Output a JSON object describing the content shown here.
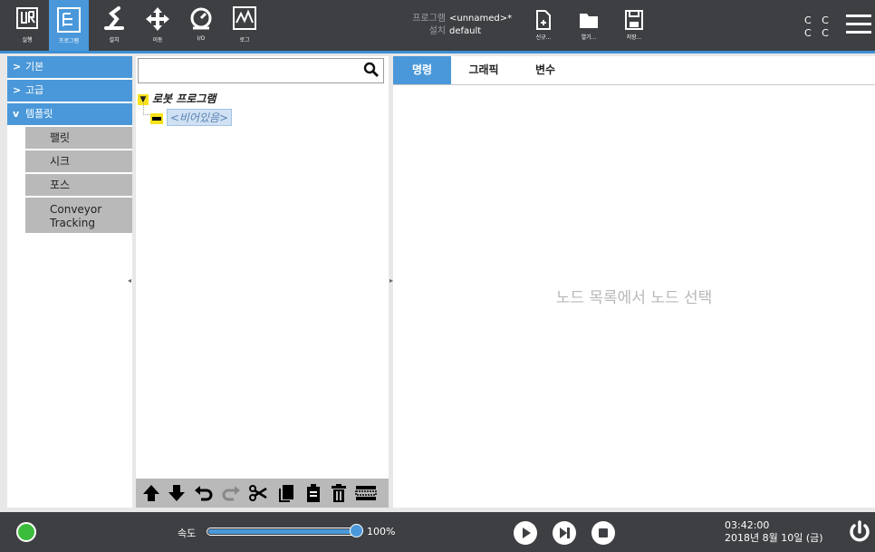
{
  "topnav": {
    "items": [
      {
        "label": "실행"
      },
      {
        "label": "프로그램"
      },
      {
        "label": "설치"
      },
      {
        "label": "이동"
      },
      {
        "label": "I/O"
      },
      {
        "label": "로그"
      }
    ]
  },
  "program_info": {
    "program_label": "프로그램",
    "program_value": "<unnamed>*",
    "install_label": "설치",
    "install_value": "default"
  },
  "file_buttons": {
    "new": "신규...",
    "open": "열기...",
    "save": "저장..."
  },
  "status": {
    "cc_top": "C C",
    "cc_bottom": "C C"
  },
  "left_panel": {
    "categories": [
      {
        "label": "기본",
        "chevron": ">"
      },
      {
        "label": "고급",
        "chevron": ">"
      },
      {
        "label": "템플릿",
        "chevron": "v"
      }
    ],
    "template_items": [
      "팰릿",
      "시크",
      "포스",
      "Conveyor Tracking"
    ]
  },
  "tree": {
    "search_placeholder": "",
    "root_label": "로봇 프로그램",
    "child_label": "<비어있음>"
  },
  "right_panel": {
    "tabs": [
      "명령",
      "그래픽",
      "변수"
    ],
    "placeholder": "노드 목록에서 노드 선택"
  },
  "footer": {
    "speed_label": "속도",
    "speed_value": "100%",
    "speed_fraction": 1.0,
    "time": "03:42:00",
    "date": "2018년 8월 10일 (금)"
  },
  "colors": {
    "accent": "#4a98d9",
    "bar": "#3d3f43",
    "led_green": "#3bbd3b",
    "tree_yellow": "#f7e21d"
  }
}
